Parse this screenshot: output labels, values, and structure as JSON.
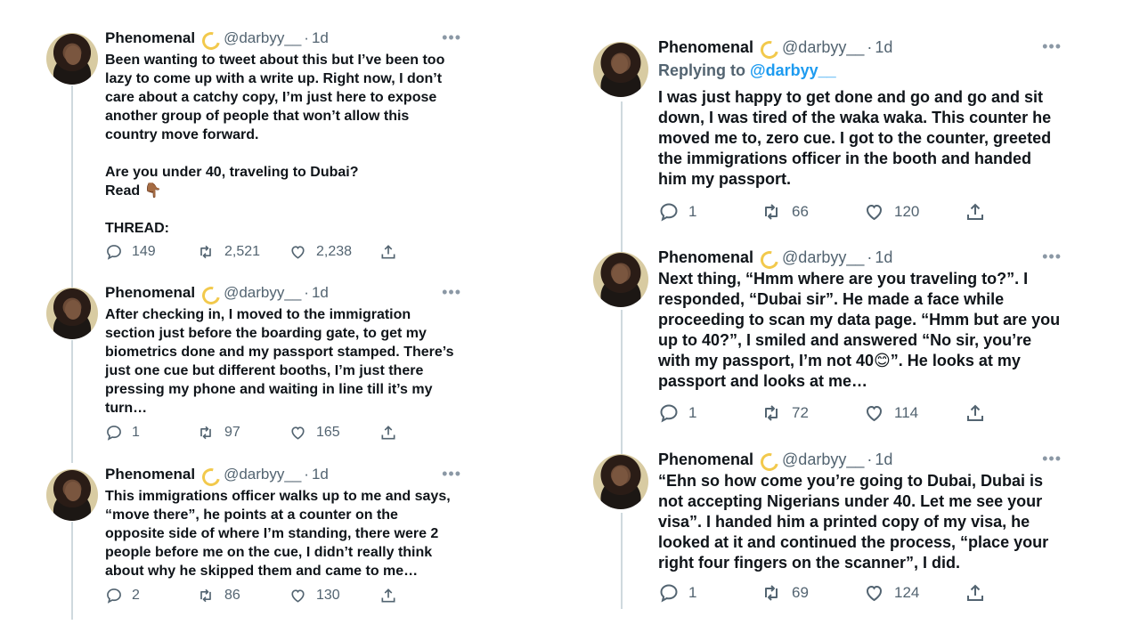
{
  "author": {
    "name": "Phenomenal",
    "handle": "@darbyy__",
    "time": "1d",
    "badge_icon": "dizzy-icon"
  },
  "left_thread": [
    {
      "text": "Been wanting to tweet about this but I’ve been too\nlazy to come up with a write up. Right now, I don’t\ncare about a catchy copy, I’m just here to expose\nanother group of people that won’t allow this\ncountry move forward.\n\nAre you under 40, traveling to Dubai?\nRead 👇🏾\n\nTHREAD:",
      "replies": "149",
      "retweets": "2,521",
      "likes": "2,238"
    },
    {
      "text": "After checking in, I moved to the immigration\nsection just before the boarding gate, to get my\nbiometrics done and my passport stamped. There’s\njust one cue but different booths, I’m just there\npressing my phone and waiting in line till it’s my\nturn…",
      "replies": "1",
      "retweets": "97",
      "likes": "165"
    },
    {
      "text": "This immigrations officer walks up to me and says,\n“move there”, he points at a counter on the\nopposite side of where I’m standing, there were 2\npeople before me on the cue, I didn’t really think\nabout why he skipped them and came to me…",
      "replies": "2",
      "retweets": "86",
      "likes": "130"
    }
  ],
  "right_thread": [
    {
      "replying_label": "Replying to",
      "replying_to": "@darbyy__",
      "text": "I was just happy to get done and go and go and sit\ndown, I was tired of the waka waka. This counter he\nmoved me to, zero cue. I got to the counter, greeted\nthe immigrations officer in the booth and handed\nhim my passport.",
      "replies": "1",
      "retweets": "66",
      "likes": "120"
    },
    {
      "text": "Next thing, “Hmm where are you traveling to?”. I\nresponded, “Dubai sir”. He made a face while\nproceeding to scan my data page. “Hmm but are you\nup to 40?”, I smiled and answered “No sir, you’re\nwith my passport, I’m not 40😊”. He looks at my\npassport and looks at me…",
      "replies": "1",
      "retweets": "72",
      "likes": "114"
    },
    {
      "text": "“Ehn so how come you’re going to Dubai, Dubai is\nnot accepting Nigerians under 40. Let me see your\nvisa”. I handed him a printed copy of my visa, he\nlooked at it and continued the process, “place your\nright four fingers on the scanner”, I did.",
      "replies": "1",
      "retweets": "69",
      "likes": "124"
    }
  ],
  "icons": {
    "more": "more-horizontal-icon",
    "reply": "reply-icon",
    "retweet": "retweet-icon",
    "like": "heart-icon",
    "share": "share-icon"
  },
  "colors": {
    "text": "#0f1419",
    "muted": "#536471",
    "link": "#1d9bf0",
    "thread_line": "#cfd9de"
  }
}
